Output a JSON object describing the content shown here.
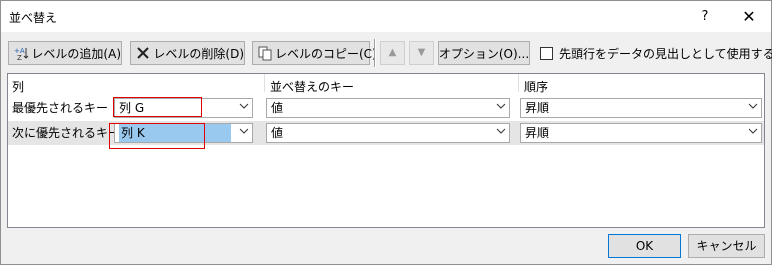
{
  "window": {
    "title": "並べ替え",
    "help": "?",
    "close": "✕"
  },
  "toolbar": {
    "add_label": "レベルの追加(A)",
    "delete_label": "レベルの削除(D)",
    "copy_label": "レベルのコピー(C)",
    "up_glyph": "▲",
    "down_glyph": "▼",
    "options_label": "オプション(O)...",
    "header_checkbox_label": "先頭行をデータの見出しとして使用する(H)",
    "header_checkbox_checked": false
  },
  "list": {
    "headers": {
      "column": "列",
      "sort_on": "並べ替えのキー",
      "order": "順序"
    },
    "rows": [
      {
        "label": "最優先されるキー",
        "column": "列 G",
        "sort_on": "値",
        "order": "昇順",
        "selected": false
      },
      {
        "label": "次に優先されるキー",
        "column": "列 K",
        "sort_on": "値",
        "order": "昇順",
        "selected": true
      }
    ]
  },
  "footer": {
    "ok_label": "OK",
    "cancel_label": "キャンセル"
  },
  "colors": {
    "selection": "#99c9ef",
    "highlight_box": "#e00000",
    "default_button_border": "#0078d7"
  },
  "icons": {
    "add": "add-level-icon",
    "delete": "delete-level-icon",
    "copy": "copy-level-icon"
  }
}
